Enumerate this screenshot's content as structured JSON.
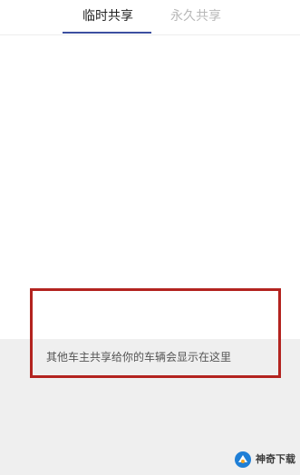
{
  "tabs": {
    "temporary_label": "临时共享",
    "permanent_label": "永久共享"
  },
  "main": {
    "empty_message": "其他车主共享给你的车辆会显示在这里"
  },
  "watermark": {
    "text": "神奇下载"
  },
  "colors": {
    "tab_active_text": "#222222",
    "tab_inactive_text": "#b8b8b8",
    "tab_indicator": "#3c4fa0",
    "highlight_border": "#b3231f",
    "gray_background": "#efefef",
    "message_text": "#555555"
  }
}
